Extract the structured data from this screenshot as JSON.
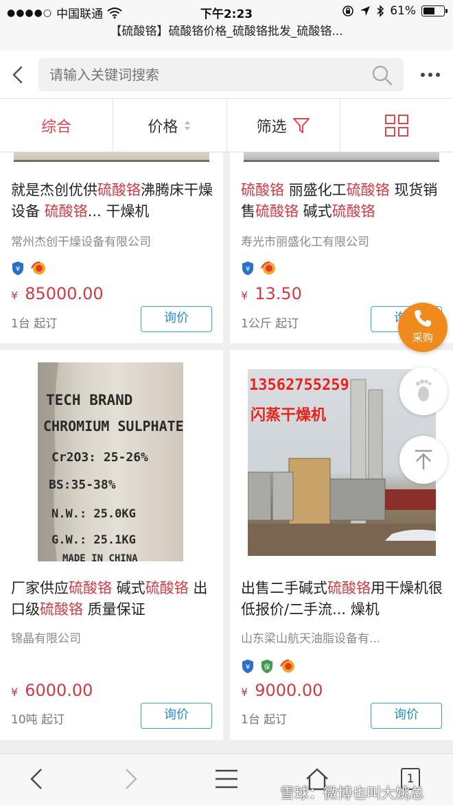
{
  "status_bar": {
    "signal_dots": "●●●●○",
    "carrier": "中国联通",
    "time": "下午2:23",
    "battery": "61%",
    "battery_level": 0.61
  },
  "browser": {
    "page_title": "【硫酸铬】硫酸铬价格_硫酸铬批发_硫酸铬..."
  },
  "search": {
    "placeholder": "请输入关键词搜索"
  },
  "filters": {
    "tabs": [
      "综合",
      "价格",
      "筛选"
    ]
  },
  "products": [
    {
      "title": [
        {
          "t": "就是杰创优供",
          "h": false
        },
        {
          "t": "硫酸铬",
          "h": true
        },
        {
          "t": "沸腾床干燥设备 ",
          "h": false
        },
        {
          "t": "硫酸铬",
          "h": true
        },
        {
          "t": "... 干燥机",
          "h": false
        }
      ],
      "company": "常州杰创干燥设备有限公司",
      "currency": "¥",
      "price": "85000.00",
      "moq": "1台 起订",
      "button": "询价"
    },
    {
      "title": [
        {
          "t": "硫酸铬",
          "h": true
        },
        {
          "t": " 丽盛化工",
          "h": false
        },
        {
          "t": "硫酸铬",
          "h": true
        },
        {
          "t": " 现货销售",
          "h": false
        },
        {
          "t": "硫酸铬",
          "h": true
        },
        {
          "t": " 碱式",
          "h": false
        },
        {
          "t": "硫酸铬",
          "h": true
        }
      ],
      "company": "寿光市丽盛化工有限公司",
      "currency": "¥",
      "price": "13.50",
      "moq": "1公斤 起订",
      "button": "询价"
    },
    {
      "image_text": [
        "TECH BRAND",
        "CHROMIUM SULPHATE",
        "Cr2O3: 25-26%",
        "BS:35-38%",
        "N.W.: 25.0KG",
        "G.W.: 25.1KG",
        "MADE IN CHINA"
      ],
      "title": [
        {
          "t": "厂家供应",
          "h": false
        },
        {
          "t": "硫酸铬",
          "h": true
        },
        {
          "t": " 碱式",
          "h": false
        },
        {
          "t": "硫酸铬",
          "h": true
        },
        {
          "t": " 出口级",
          "h": false
        },
        {
          "t": "硫酸铬",
          "h": true
        },
        {
          "t": " 质量保证",
          "h": false
        }
      ],
      "company": "锦晶有限公司",
      "currency": "¥",
      "price": "6000.00",
      "moq": "10吨 起订",
      "button": "询价"
    },
    {
      "image_text": [
        "13562755259",
        "闪蒸干燥机"
      ],
      "title": [
        {
          "t": "出售二手碱式",
          "h": false
        },
        {
          "t": "硫酸铬",
          "h": true
        },
        {
          "t": "用干燥机很低报价/二手流... 燥机",
          "h": false
        }
      ],
      "company": "山东梁山航天油脂设备有...",
      "currency": "¥",
      "price": "9000.00",
      "moq": "1台 起订",
      "button": "询价"
    }
  ],
  "floating": {
    "buy_label": "采购"
  },
  "toolbar": {
    "tab_count": "1"
  },
  "watermark": "雪球：微博也叫大姚总",
  "colors": {
    "accent_red": "#d03a44",
    "inquiry_blue": "#1f8bd0",
    "buy_orange": "#f08a1c"
  }
}
